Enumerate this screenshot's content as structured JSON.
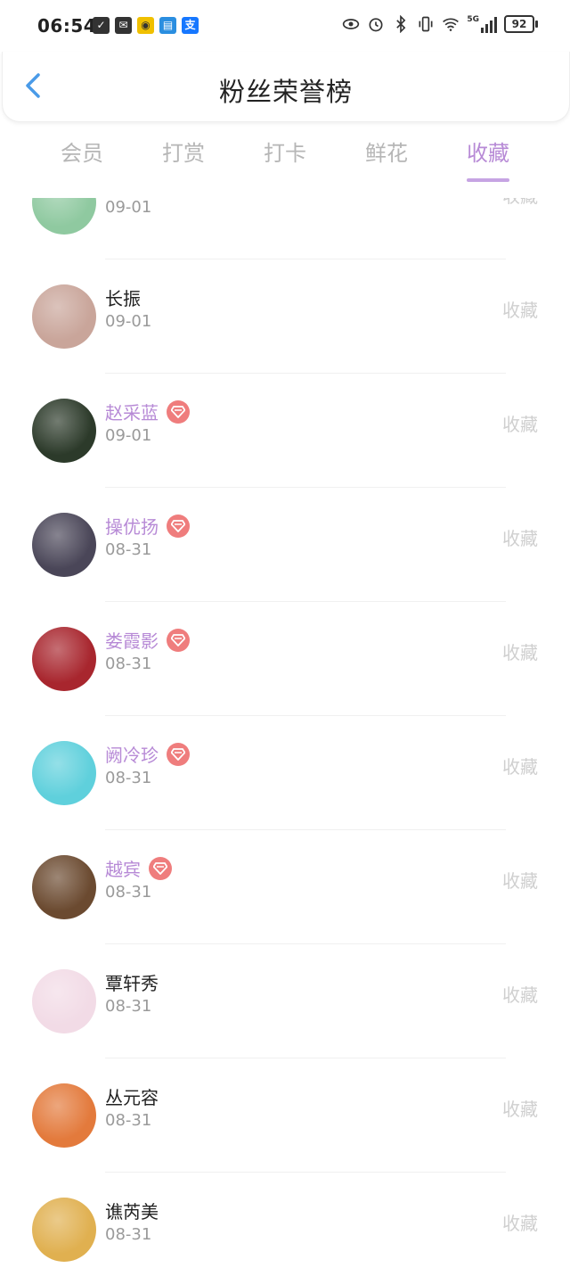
{
  "status_bar": {
    "time": "06:54",
    "battery": "92",
    "signal_label": "5G"
  },
  "header": {
    "title": "粉丝荣誉榜"
  },
  "tabs": [
    {
      "label": "会员",
      "active": false
    },
    {
      "label": "打赏",
      "active": false
    },
    {
      "label": "打卡",
      "active": false
    },
    {
      "label": "鲜花",
      "active": false
    },
    {
      "label": "收藏",
      "active": true
    }
  ],
  "list": [
    {
      "name": "",
      "date": "09-01",
      "vip": false,
      "action": "收藏",
      "avatar_color": "#8fc9a0"
    },
    {
      "name": "长振",
      "date": "09-01",
      "vip": false,
      "action": "收藏",
      "avatar_color": "#c9a59a"
    },
    {
      "name": "赵采蓝",
      "date": "09-01",
      "vip": true,
      "action": "收藏",
      "avatar_color": "#2c3a2a"
    },
    {
      "name": "操优扬",
      "date": "08-31",
      "vip": true,
      "action": "收藏",
      "avatar_color": "#4a4658"
    },
    {
      "name": "娄霞影",
      "date": "08-31",
      "vip": true,
      "action": "收藏",
      "avatar_color": "#a8262e"
    },
    {
      "name": "阙冷珍",
      "date": "08-31",
      "vip": true,
      "action": "收藏",
      "avatar_color": "#5fd0dc"
    },
    {
      "name": "越宾",
      "date": "08-31",
      "vip": true,
      "action": "收藏",
      "avatar_color": "#6b4a30"
    },
    {
      "name": "覃轩秀",
      "date": "08-31",
      "vip": false,
      "action": "收藏",
      "avatar_color": "#f2dbe6"
    },
    {
      "name": "丛元容",
      "date": "08-31",
      "vip": false,
      "action": "收藏",
      "avatar_color": "#e37a3c"
    },
    {
      "name": "谯芮美",
      "date": "08-31",
      "vip": false,
      "action": "收藏",
      "avatar_color": "#e0b050"
    }
  ],
  "colors": {
    "accent": "#b78ad6",
    "vip_badge": "#ef7d7d",
    "back_arrow": "#4a9be8"
  }
}
